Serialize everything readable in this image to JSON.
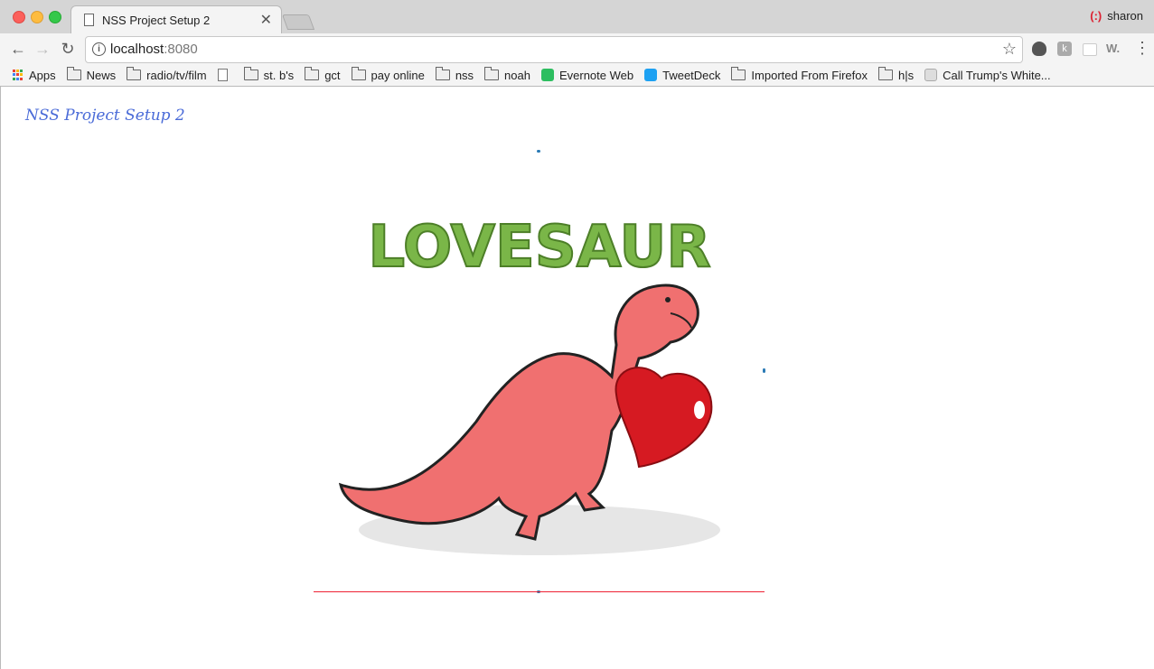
{
  "browser": {
    "tab_title": "NSS Project Setup 2",
    "tab_close": "✕",
    "profile_name": "sharon",
    "profile_icon": "(:)",
    "url_host": "localhost",
    "url_port": ":8080",
    "nav_back": "←",
    "nav_forward": "→",
    "nav_reload": "↻",
    "star": "☆",
    "menu": "⋮",
    "ext_k": "k",
    "ext_w": "W."
  },
  "bookmarks": [
    {
      "label": "Apps",
      "icon": "apps-grid-icon"
    },
    {
      "label": "News",
      "icon": "folder-icon"
    },
    {
      "label": "radio/tv/film",
      "icon": "folder-icon"
    },
    {
      "label": "",
      "icon": "page-icon"
    },
    {
      "label": "st. b's",
      "icon": "folder-icon"
    },
    {
      "label": "gct",
      "icon": "folder-icon"
    },
    {
      "label": "pay online",
      "icon": "folder-icon"
    },
    {
      "label": "nss",
      "icon": "folder-icon"
    },
    {
      "label": "noah",
      "icon": "folder-icon"
    },
    {
      "label": "Evernote Web",
      "icon": "evernote-icon"
    },
    {
      "label": "TweetDeck",
      "icon": "tweetdeck-icon"
    },
    {
      "label": "Imported From Firefox",
      "icon": "folder-icon"
    },
    {
      "label": "h|s",
      "icon": "folder-icon"
    },
    {
      "label": "Call Trump's White...",
      "icon": "whitehouse-icon"
    }
  ],
  "page": {
    "heading": "NSS Project Setup 2",
    "logo_text": "LOVESAUR"
  },
  "colors": {
    "heading": "#4a6bd8",
    "logo_green": "#7ab648",
    "dino": "#f07070",
    "heart": "#d61a22",
    "underline": "#e22233"
  }
}
